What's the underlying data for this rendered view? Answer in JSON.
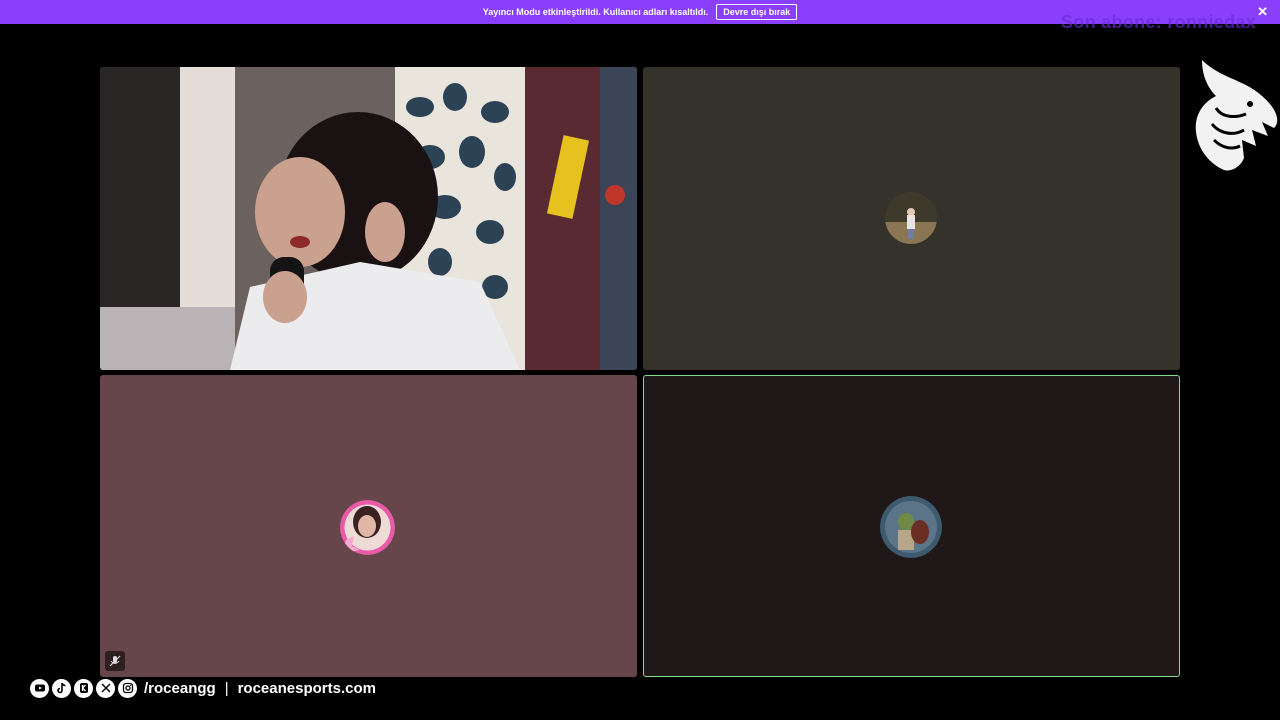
{
  "banner": {
    "message": "Yayıncı Modu etkinleştirildi. Kullanıcı adları kısaltıldı.",
    "button_label": "Devre dışı bırak",
    "close_glyph": "✕"
  },
  "overlay": {
    "latest_sub": "Son abone: ronniedax"
  },
  "footer": {
    "handle": "/roceangg",
    "separator": "|",
    "website": "roceanesports.com",
    "social_icons": [
      "youtube-icon",
      "tiktok-icon",
      "kick-icon",
      "x-icon",
      "instagram-icon"
    ]
  },
  "colors": {
    "banner": "#8a3ffc",
    "speaking_border": "#7fdc8b",
    "tile_top_right": "#35322b",
    "tile_bottom_left": "#66464a",
    "tile_bottom_right": "#201818"
  }
}
